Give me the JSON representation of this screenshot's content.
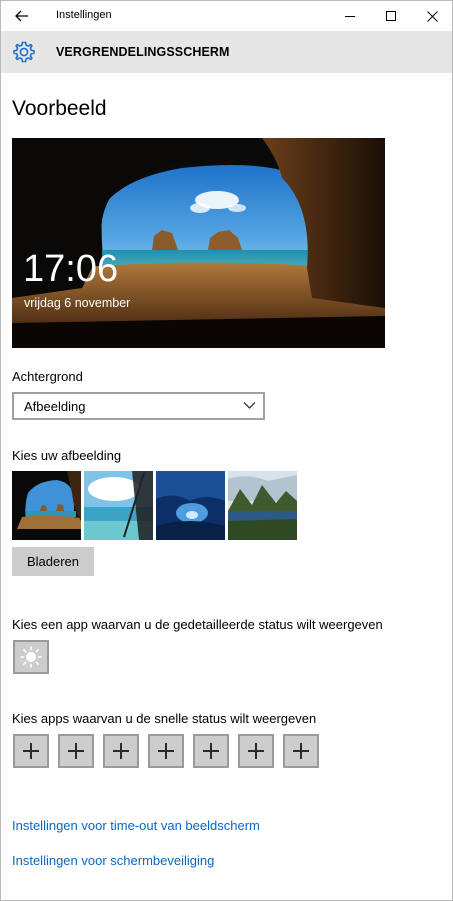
{
  "window": {
    "title": "Instellingen",
    "back_icon": "arrow-left-icon",
    "minimize_icon": "minimize-icon",
    "maximize_icon": "maximize-icon",
    "close_icon": "close-icon"
  },
  "header": {
    "icon": "gear-icon",
    "title": "VERGRENDELINGSSCHERM"
  },
  "preview": {
    "section_title": "Voorbeeld",
    "time": "17:06",
    "date": "vrijdag 6 november"
  },
  "background": {
    "label": "Achtergrond",
    "selected": "Afbeelding"
  },
  "images": {
    "label": "Kies uw afbeelding",
    "browse_label": "Bladeren"
  },
  "detailed_status": {
    "label": "Kies een app waarvan u de gedetailleerde status wilt weergeven",
    "app_icon": "sun-weather-icon"
  },
  "quick_status": {
    "label": "Kies apps waarvan u de snelle status wilt weergeven",
    "slot_icon": "plus-icon"
  },
  "links": {
    "timeout": "Instellingen voor time-out van beeldscherm",
    "screensaver": "Instellingen voor schermbeveiliging"
  },
  "colors": {
    "accent": "#0a68c2",
    "header_bg": "#e6e6e6",
    "button_bg": "#cccccc"
  }
}
